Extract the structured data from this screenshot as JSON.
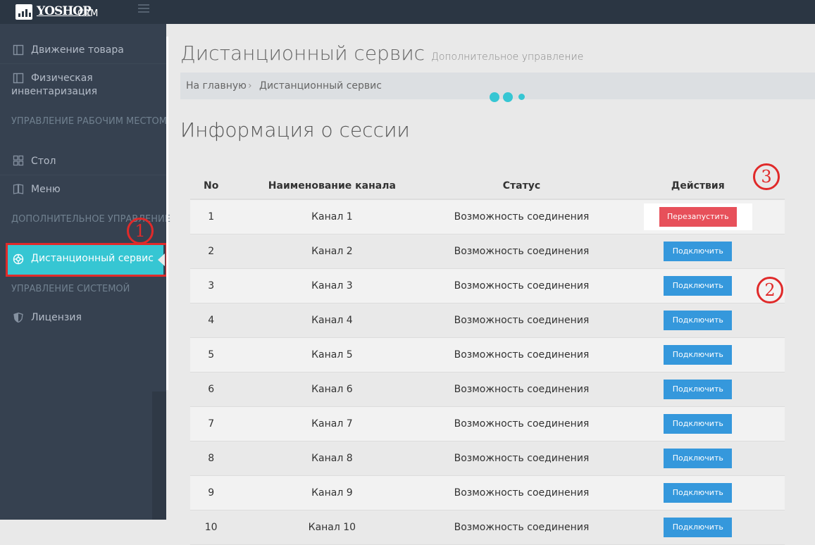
{
  "header": {
    "logo_text": "YOSHOP",
    "logo_suffix": "CRM"
  },
  "sidebar": {
    "items": [
      {
        "label": "Движение товара",
        "icon": "grid-icon"
      },
      {
        "label": "Физическая инвентаризация",
        "icon": "grid-icon"
      },
      {
        "label": "Стол",
        "icon": "table-icon"
      },
      {
        "label": "Меню",
        "icon": "book-icon"
      },
      {
        "label": "Дистанционный сервис",
        "icon": "remote-icon"
      },
      {
        "label": "Лицензия",
        "icon": "shield-icon"
      }
    ],
    "headers": [
      "УПРАВЛЕНИЕ РАБОЧИМ МЕСТОМ",
      "ДОПОЛНИТЕЛЬНОЕ УПРАВЛЕНИЕ",
      "УПРАВЛЕНИЕ СИСТЕМОЙ"
    ],
    "active": "Дистанционный сервис"
  },
  "page": {
    "title": "Дистанционный сервис",
    "subtitle": "Дополнительное управление",
    "breadcrumb": [
      "На главную",
      "Дистанционный сервис"
    ],
    "section_title": "Информация о сессии"
  },
  "table": {
    "columns": [
      "No",
      "Наименование канала",
      "Статус",
      "Действия"
    ],
    "rows": [
      {
        "no": "1",
        "channel": "Канал 1",
        "status": "Возможность соединения",
        "action": "Перезапустить"
      },
      {
        "no": "2",
        "channel": "Канал 2",
        "status": "Возможность соединения",
        "action": "Подключить"
      },
      {
        "no": "3",
        "channel": "Канал 3",
        "status": "Возможность соединения",
        "action": "Подключить"
      },
      {
        "no": "4",
        "channel": "Канал 4",
        "status": "Возможность соединения",
        "action": "Подключить"
      },
      {
        "no": "5",
        "channel": "Канал 5",
        "status": "Возможность соединения",
        "action": "Подключить"
      },
      {
        "no": "6",
        "channel": "Канал 6",
        "status": "Возможность соединения",
        "action": "Подключить"
      },
      {
        "no": "7",
        "channel": "Канал 7",
        "status": "Возможность соединения",
        "action": "Подключить"
      },
      {
        "no": "8",
        "channel": "Канал 8",
        "status": "Возможность соединения",
        "action": "Подключить"
      },
      {
        "no": "9",
        "channel": "Канал 9",
        "status": "Возможность соединения",
        "action": "Подключить"
      },
      {
        "no": "10",
        "channel": "Канал 10",
        "status": "Возможность соединения",
        "action": "Подключить"
      }
    ]
  },
  "annotations": [
    "1",
    "2",
    "3"
  ],
  "colors": {
    "accent": "#36c6d3",
    "primary_button": "#3598dc",
    "danger_button": "#e7505a",
    "annotation": "#e02a2a",
    "sidebar": "#364150"
  }
}
